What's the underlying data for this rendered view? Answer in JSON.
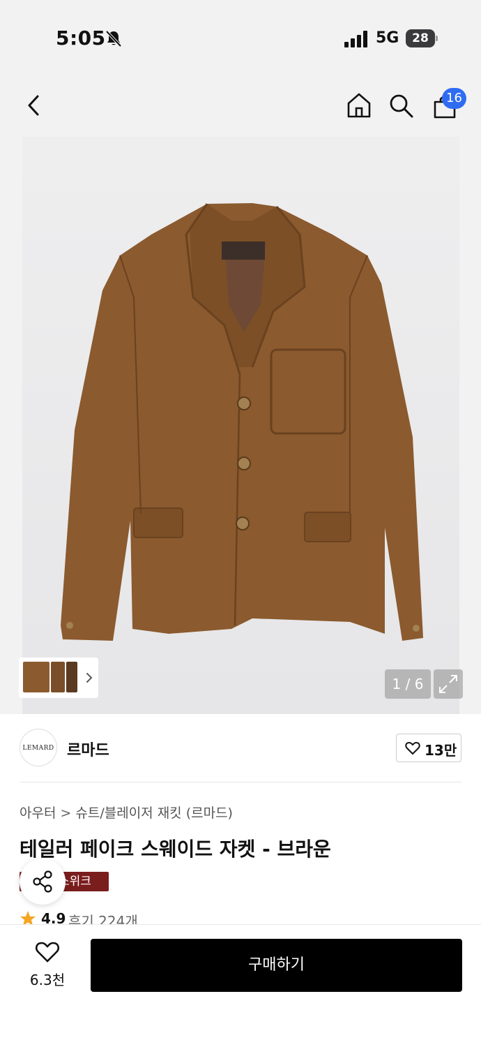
{
  "status_bar": {
    "time": "5:05",
    "network": "5G",
    "battery": "28",
    "icons": [
      "bell-slash-icon",
      "signal-icon",
      "battery-icon"
    ]
  },
  "nav": {
    "icons": [
      "back-icon",
      "home-icon",
      "search-icon",
      "cart-icon"
    ],
    "cart_badge": "16"
  },
  "gallery": {
    "page_indicator": "1 / 6",
    "icons": [
      "thumbnail-strip",
      "chevron-right-icon",
      "expand-icon"
    ]
  },
  "brand": {
    "logo_text": "LEMARD",
    "name": "르마드",
    "likes": "13만"
  },
  "product": {
    "category": "아우터",
    "subcategory": "슈트/블레이저 재킷 (르마드)",
    "title": "테일러 페이크 스웨이드 자켓 - 브라운",
    "tag": "스위크",
    "rating": "4.9",
    "reviews": "후기 224개"
  },
  "bottom_bar": {
    "wish_count": "6.3천",
    "buy_label": "구매하기"
  },
  "colors": {
    "accent_badge": "#2f6cf2",
    "tag_background": "#7a1d1d",
    "buy_button": "#000000",
    "star": "#f5a623",
    "jacket": "#8b5a2e"
  }
}
